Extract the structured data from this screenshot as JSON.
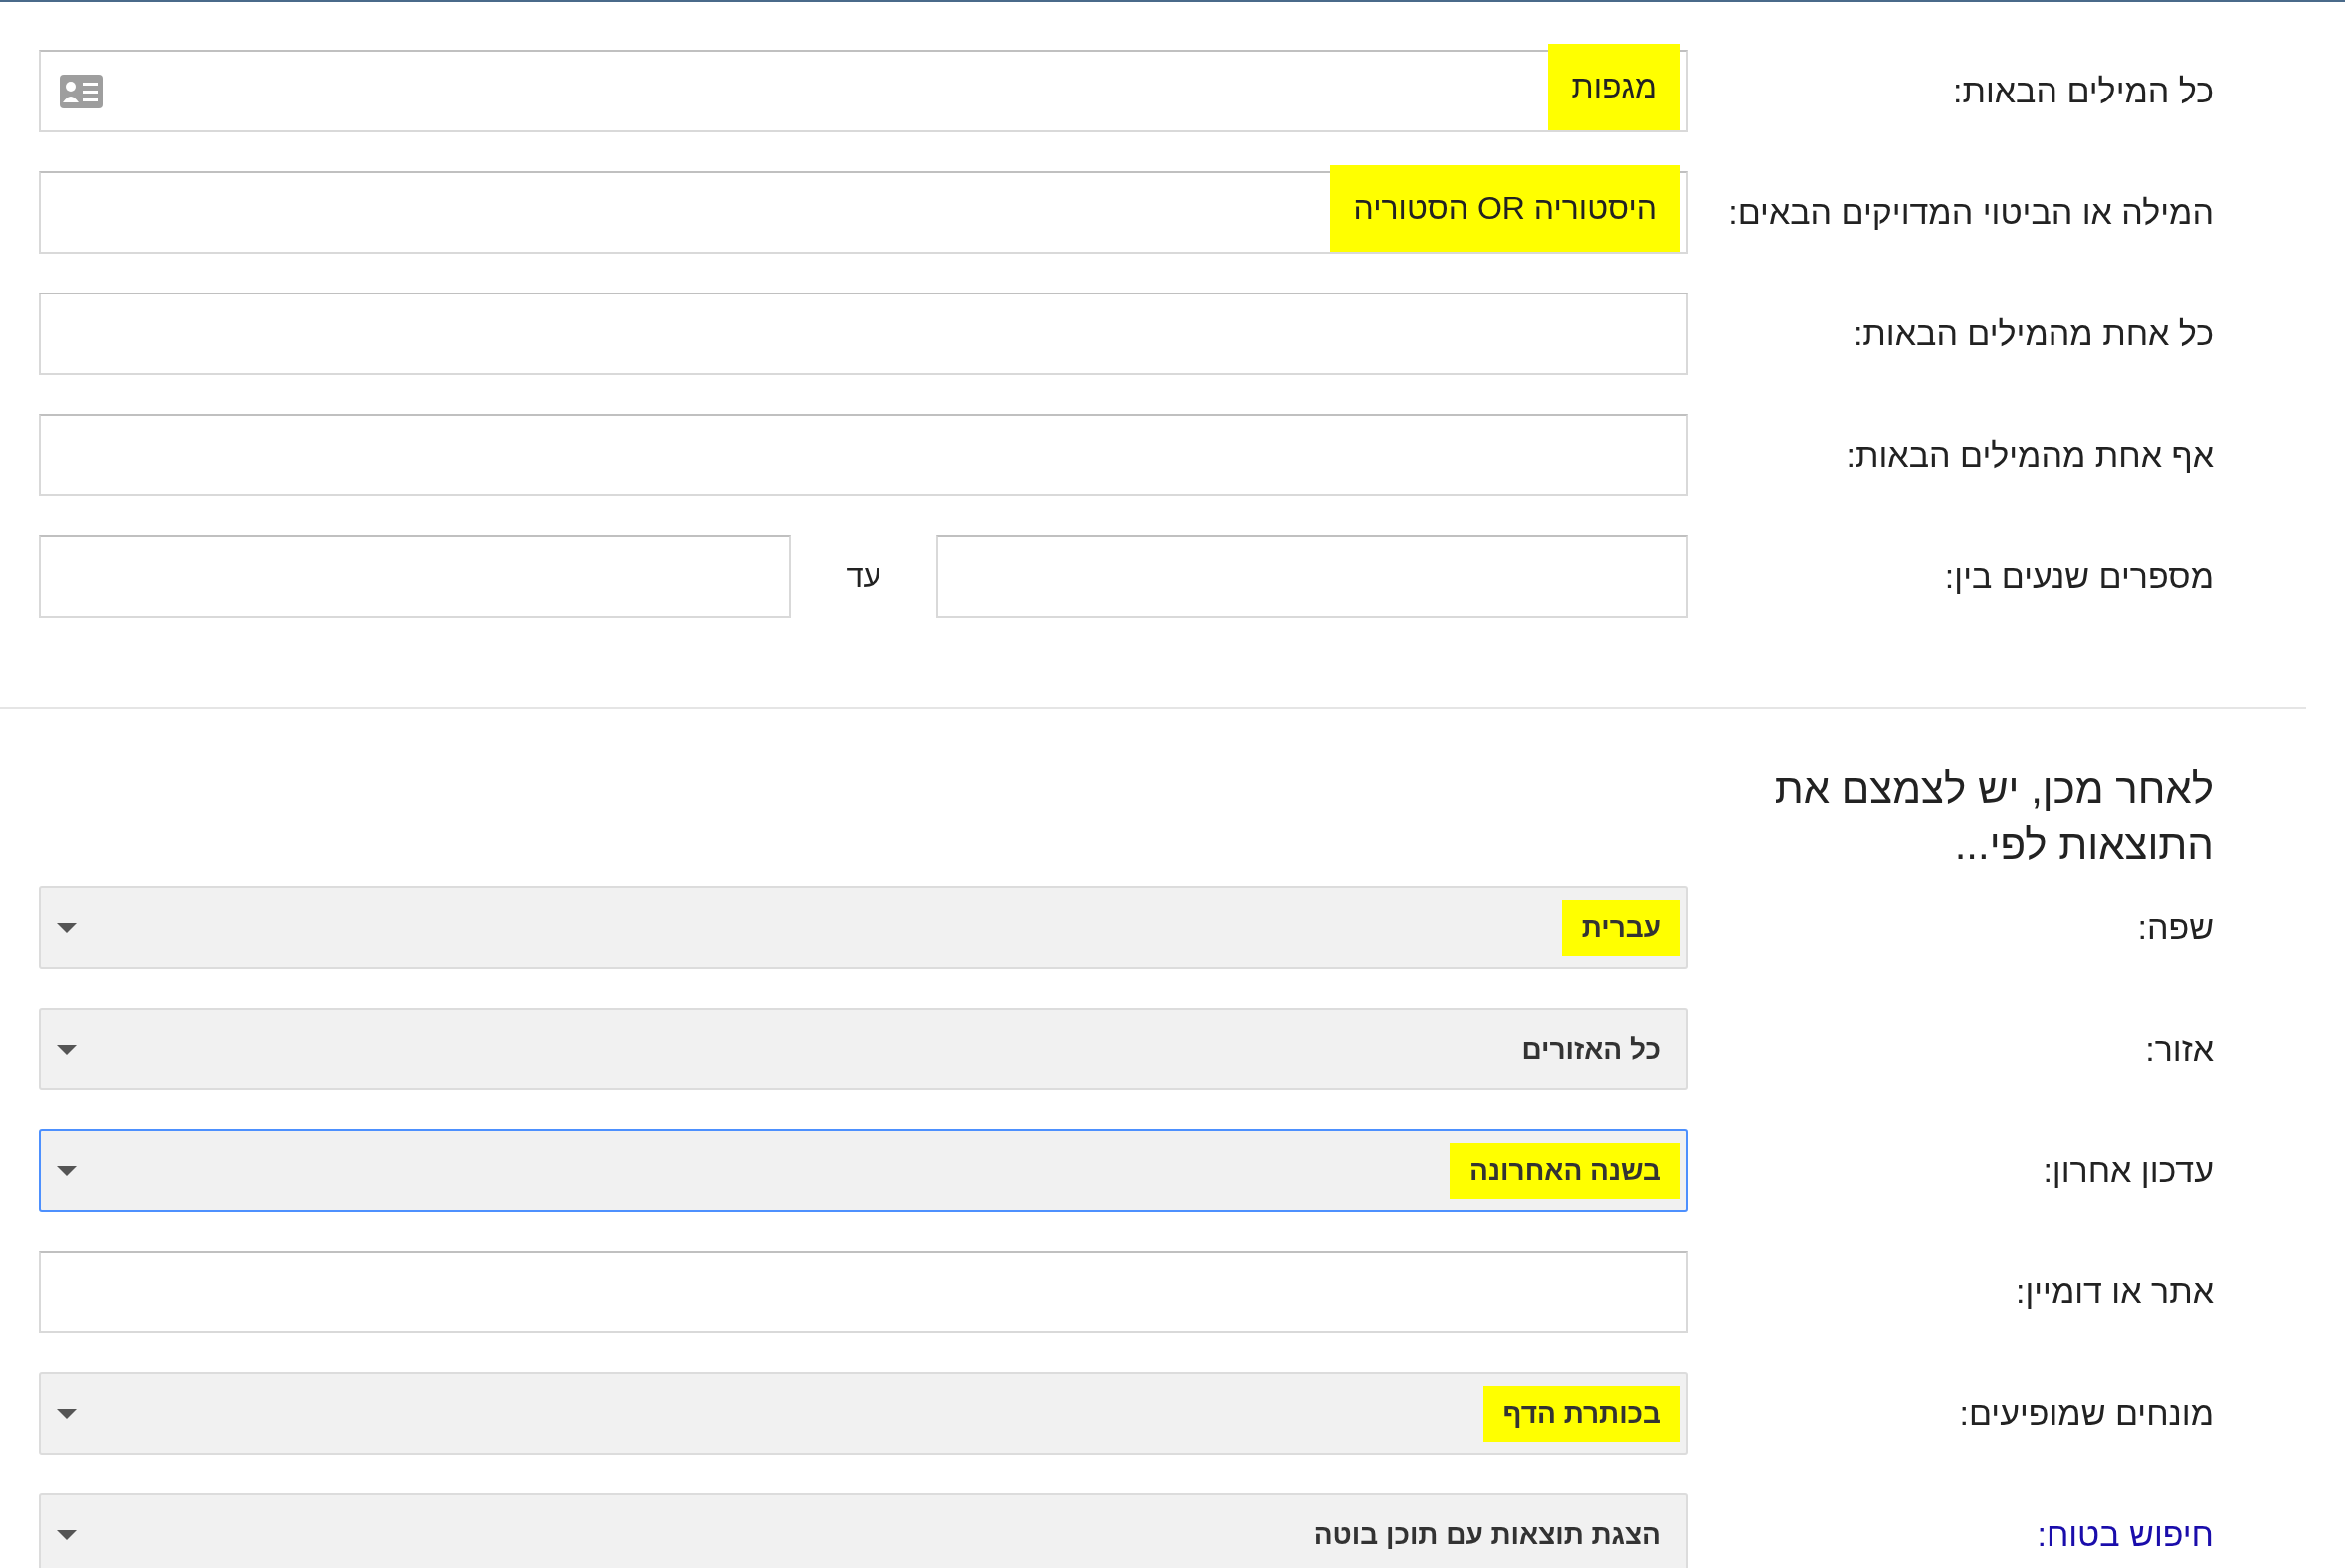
{
  "find_rows": [
    {
      "kind": "text",
      "label": "כל המילים הבאות:",
      "value": "מגפות",
      "highlighted": true,
      "card_icon": true
    },
    {
      "kind": "text",
      "label": "המילה או הביטוי המדויקים הבאים:",
      "value": "היסטוריה OR הסטוריה",
      "highlighted": true
    },
    {
      "kind": "text",
      "label": "כל אחת מהמילים הבאות:"
    },
    {
      "kind": "text",
      "label": "אף אחת מהמילים הבאות:"
    },
    {
      "kind": "range",
      "label": "מספרים שנעים בין:",
      "separator": "עד"
    }
  ],
  "narrow_heading": "לאחר מכן, יש לצמצם את התוצאות לפי...",
  "narrow_rows": [
    {
      "kind": "select",
      "label": "שפה:",
      "value": "עברית",
      "highlighted": true,
      "focused": false
    },
    {
      "kind": "select",
      "label": "אזור:",
      "value": "כל האזורים",
      "highlighted": false,
      "focused": false
    },
    {
      "kind": "select",
      "label": "עדכון אחרון:",
      "value": "בשנה האחרונה",
      "highlighted": true,
      "focused": true
    },
    {
      "kind": "text",
      "label": "אתר או דומיין:"
    },
    {
      "kind": "select",
      "label": "מונחים שמופיעים:",
      "value": "בכותרת הדף",
      "highlighted": true,
      "focused": false
    },
    {
      "kind": "select",
      "label": "חיפוש בטוח:",
      "label_link": true,
      "value": "הצגת תוצאות עם תוכן בוטה",
      "highlighted": false,
      "focused": false
    }
  ]
}
